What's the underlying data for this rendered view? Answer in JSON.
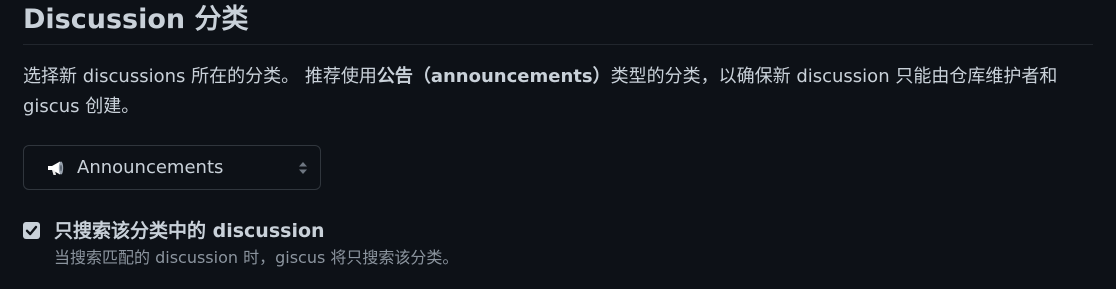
{
  "section": {
    "title": "Discussion 分类",
    "description": {
      "part1": "选择新 discussions 所在的分类。 推荐使用",
      "bold": "公告（announcements）",
      "part2": "类型的分类，以确保新 discussion 只能由仓库维护者和 giscus 创建。"
    }
  },
  "category_select": {
    "icon": "megaphone-icon",
    "selected": "Announcements"
  },
  "strict_search": {
    "checked": true,
    "label": "只搜索该分类中的 discussion",
    "hint": "当搜索匹配的 discussion 时，giscus 将只搜索该分类。"
  },
  "colors": {
    "background": "#0d1117",
    "text": "#c9d1d9",
    "muted": "#8b949e",
    "border": "#30363d"
  }
}
